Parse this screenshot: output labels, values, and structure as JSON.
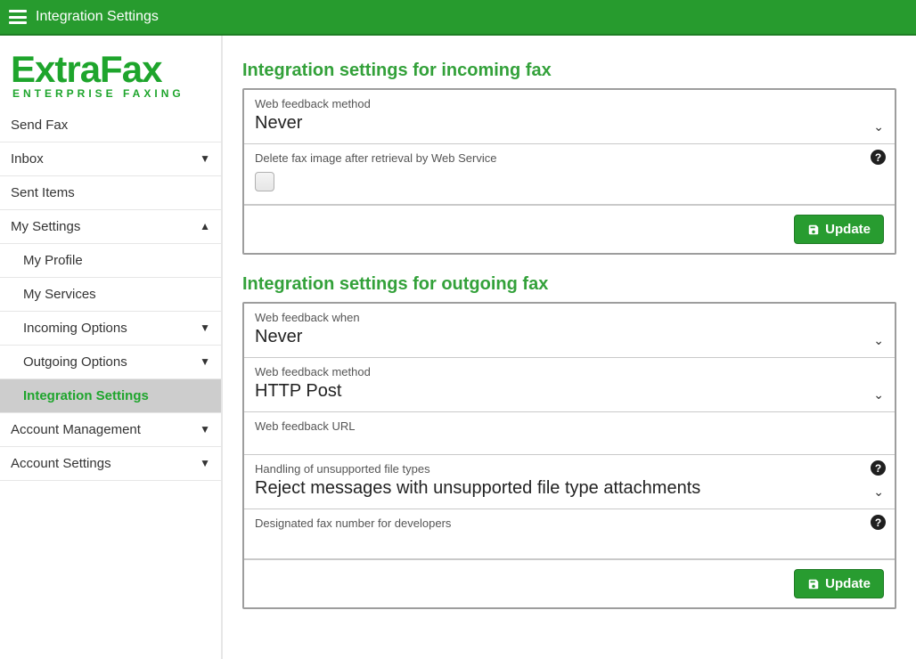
{
  "header": {
    "title": "Integration Settings"
  },
  "logo": {
    "top": "ExtraFax",
    "sub": "ENTERPRISE FAXING"
  },
  "sidebar": {
    "items": [
      {
        "label": "Send Fax"
      },
      {
        "label": "Inbox",
        "caret": "▼"
      },
      {
        "label": "Sent Items"
      },
      {
        "label": "My Settings",
        "caret": "▲"
      },
      {
        "label": "My Profile",
        "sub": true
      },
      {
        "label": "My Services",
        "sub": true
      },
      {
        "label": "Incoming Options",
        "sub": true,
        "caret": "▼"
      },
      {
        "label": "Outgoing Options",
        "sub": true,
        "caret": "▼"
      },
      {
        "label": "Integration Settings",
        "sub": true,
        "active": true
      },
      {
        "label": "Account Management",
        "caret": "▼"
      },
      {
        "label": "Account Settings",
        "caret": "▼"
      }
    ]
  },
  "sections": {
    "incoming": {
      "title": "Integration settings for incoming fax",
      "web_feedback_method": {
        "label": "Web feedback method",
        "value": "Never"
      },
      "delete_after_retrieval": {
        "label": "Delete fax image after retrieval by Web Service"
      },
      "update_label": "Update"
    },
    "outgoing": {
      "title": "Integration settings for outgoing fax",
      "web_feedback_when": {
        "label": "Web feedback when",
        "value": "Never"
      },
      "web_feedback_method": {
        "label": "Web feedback method",
        "value": "HTTP Post"
      },
      "web_feedback_url": {
        "label": "Web feedback URL",
        "value": ""
      },
      "unsupported_handling": {
        "label": "Handling of unsupported file types",
        "value": "Reject messages with unsupported file type attachments"
      },
      "designated_fax_number": {
        "label": "Designated fax number for developers",
        "value": ""
      },
      "update_label": "Update"
    }
  }
}
